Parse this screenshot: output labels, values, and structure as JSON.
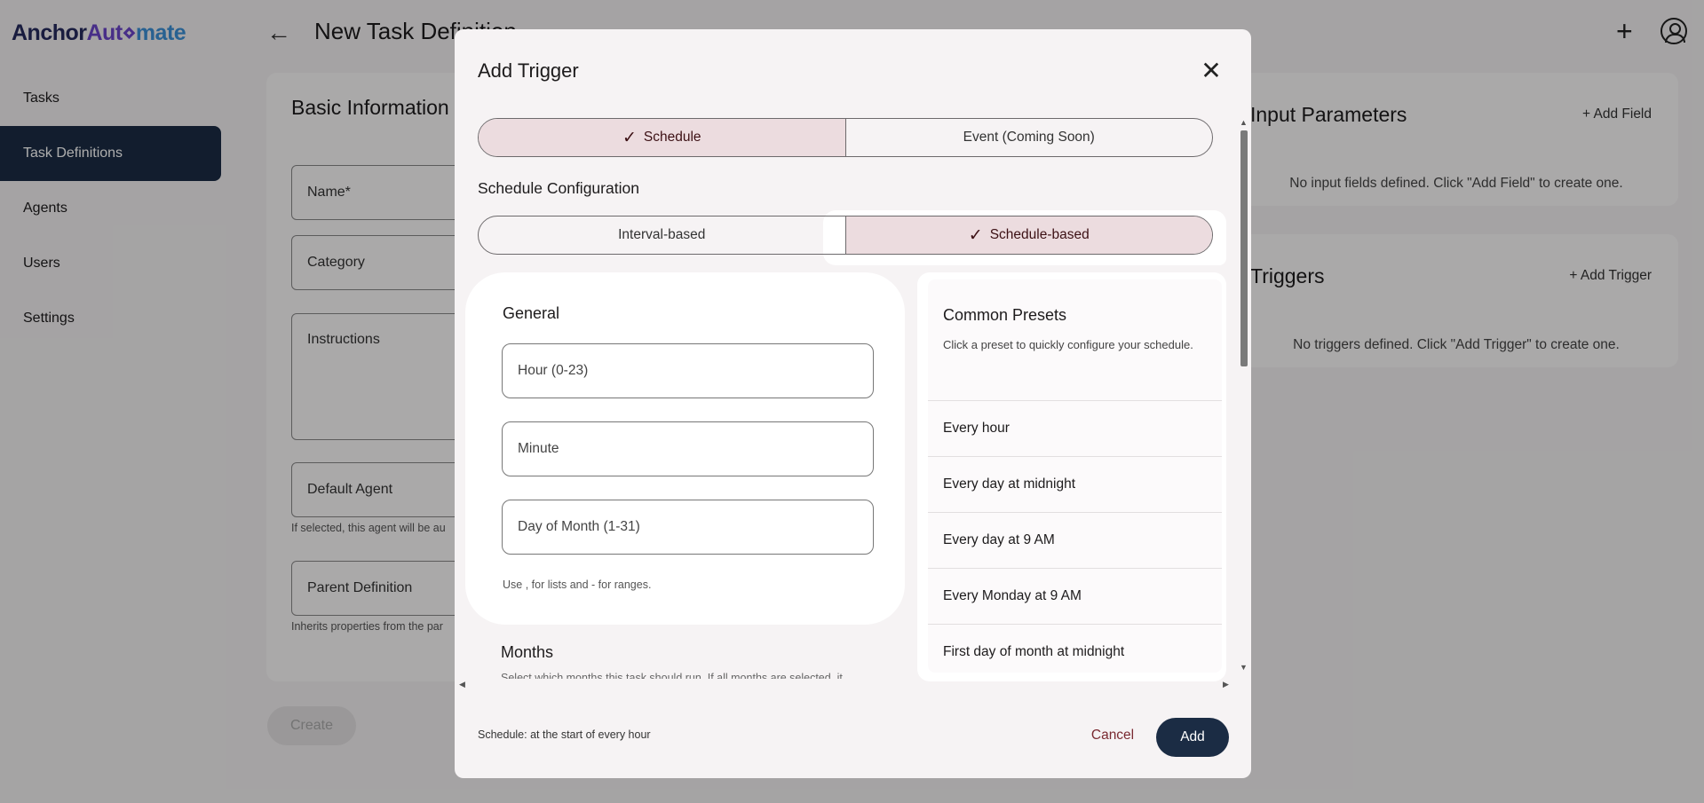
{
  "brand": {
    "part1": "Anchor",
    "part2": "Aut",
    "part3": "⋄",
    "part4": "mate"
  },
  "header": {
    "back_icon": "←",
    "title": "New Task Definition",
    "add_icon": "+"
  },
  "sidebar": {
    "items": [
      {
        "label": "Tasks"
      },
      {
        "label": "Task Definitions",
        "active": true
      },
      {
        "label": "Agents"
      },
      {
        "label": "Users"
      },
      {
        "label": "Settings"
      }
    ]
  },
  "basic_info": {
    "title": "Basic Information",
    "name_label": "Name*",
    "category_label": "Category",
    "instructions_label": "Instructions",
    "default_agent_label": "Default Agent",
    "default_agent_help": "If selected, this agent will be au",
    "parent_label": "Parent Definition",
    "parent_help": "Inherits properties from the par",
    "create_label": "Create"
  },
  "input_params": {
    "title": "Input Parameters",
    "add_label": "+   Add Field",
    "empty": "No input fields defined. Click \"Add Field\" to create one."
  },
  "triggers": {
    "title": "Triggers",
    "add_label": "+   Add Trigger",
    "empty": "No triggers defined. Click \"Add Trigger\" to create one."
  },
  "dialog": {
    "title": "Add Trigger",
    "close_icon": "✕",
    "type_tabs": {
      "schedule": "Schedule",
      "event": "Event (Coming Soon)",
      "check": "✓"
    },
    "section_label": "Schedule Configuration",
    "mode_tabs": {
      "interval": "Interval-based",
      "schedule": "Schedule-based",
      "check": "✓"
    },
    "general": {
      "title": "General",
      "hour_label": "Hour (0-23)",
      "minute_label": "Minute",
      "dom_label": "Day of Month (1-31)",
      "hint": "Use , for lists and - for ranges."
    },
    "months": {
      "title": "Months",
      "desc": "Select which months this task should run. If all months are selected, it"
    },
    "presets": {
      "title": "Common Presets",
      "desc": "Click a preset to quickly configure your schedule.",
      "items": [
        "Every hour",
        "Every day at midnight",
        "Every day at 9 AM",
        "Every Monday at 9 AM",
        "First day of month at midnight"
      ]
    },
    "status": "Schedule: at the start of every hour",
    "cancel_label": "Cancel",
    "add_label": "Add"
  },
  "colors": {
    "nav_active": "#1b2c44",
    "selected_tab": "#ecdcdf",
    "primary_button": "#1b2c44",
    "cancel_text": "#7a2a31"
  }
}
